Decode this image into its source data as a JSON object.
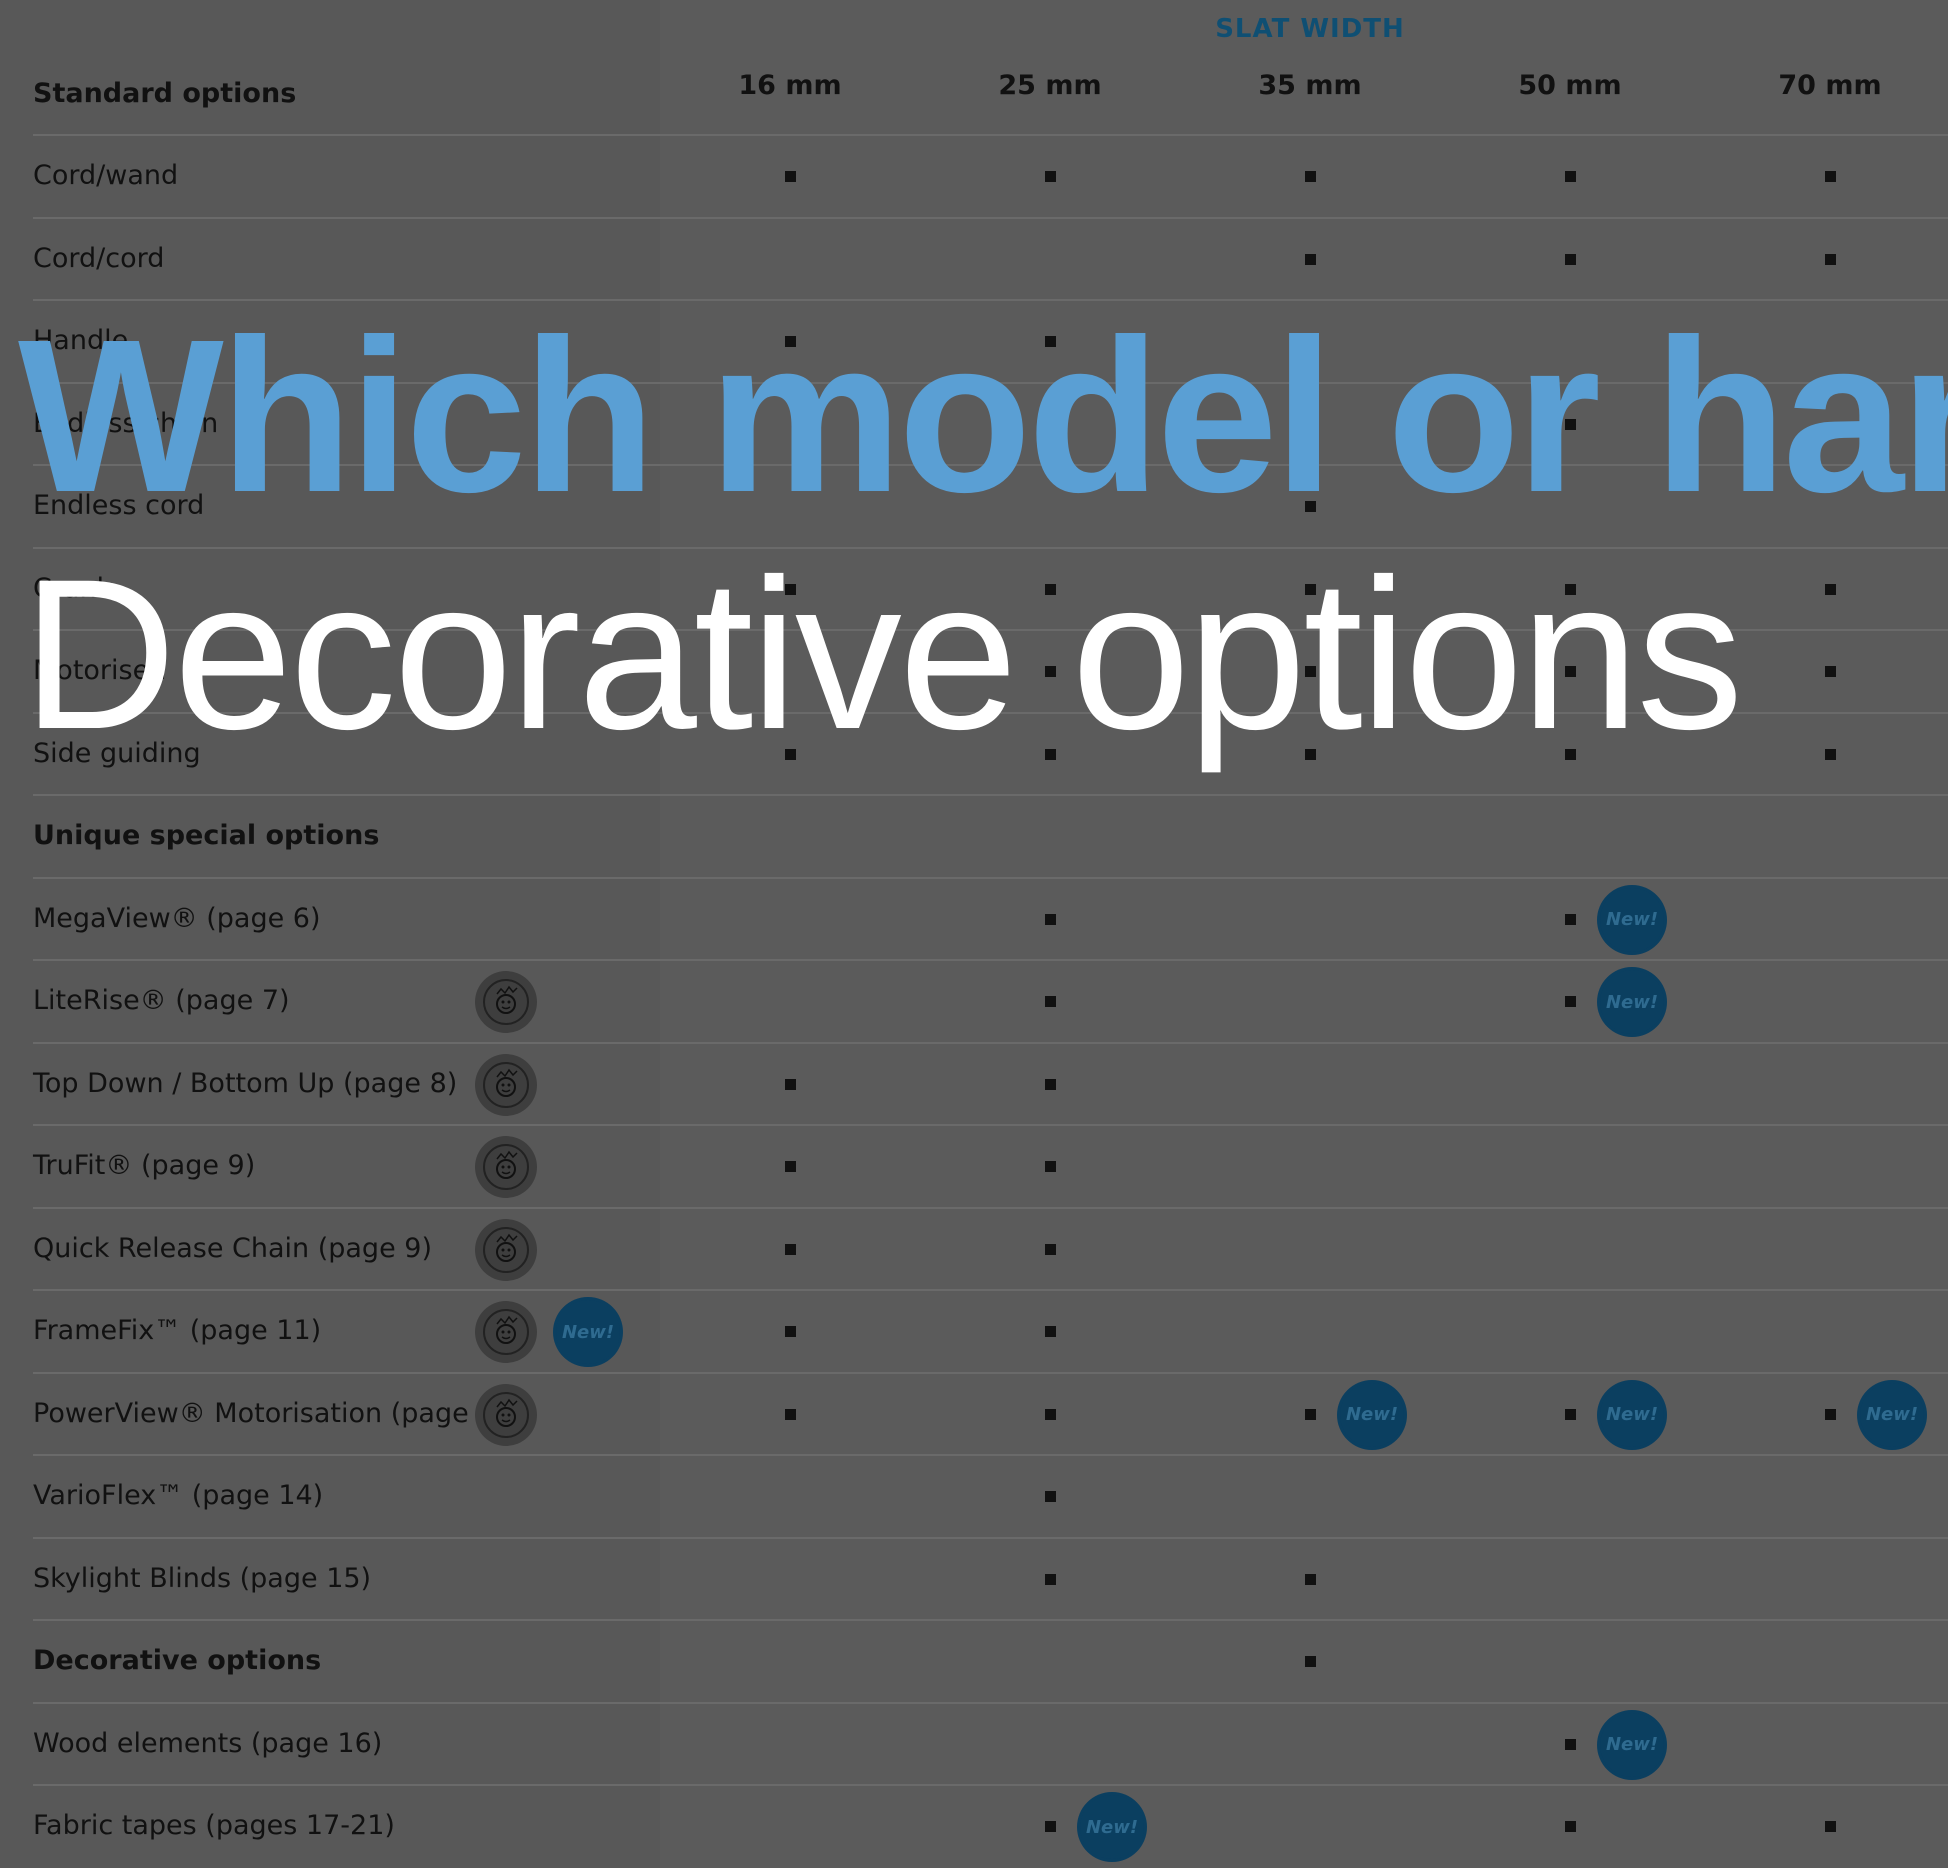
{
  "header": {
    "slat_width_label": "SLAT WIDTH",
    "section_standard": "Standard options",
    "columns": [
      "16 mm",
      "25 mm",
      "35 mm",
      "50 mm",
      "70 mm"
    ]
  },
  "rows": [
    {
      "label": "Cord/wand",
      "marks": [
        1,
        1,
        1,
        1,
        1
      ],
      "bold": false,
      "child_friendly": false,
      "badge_new_label": false,
      "new_after": []
    },
    {
      "label": "Cord/cord",
      "marks": [
        0,
        0,
        1,
        1,
        1
      ],
      "bold": false,
      "child_friendly": false,
      "badge_new_label": false,
      "new_after": []
    },
    {
      "label": "Handle",
      "marks": [
        1,
        1,
        0,
        0,
        0
      ],
      "bold": false,
      "child_friendly": false,
      "badge_new_label": false,
      "new_after": []
    },
    {
      "label": "Endless chain",
      "marks": [
        0,
        1,
        0,
        1,
        0
      ],
      "bold": false,
      "child_friendly": false,
      "badge_new_label": false,
      "new_after": []
    },
    {
      "label": "Endless cord",
      "marks": [
        0,
        0,
        1,
        0,
        0
      ],
      "bold": false,
      "child_friendly": false,
      "badge_new_label": false,
      "new_after": []
    },
    {
      "label": "Crank",
      "marks": [
        1,
        1,
        1,
        1,
        1
      ],
      "bold": false,
      "child_friendly": false,
      "badge_new_label": false,
      "new_after": []
    },
    {
      "label": "Motorised",
      "marks": [
        0,
        1,
        1,
        1,
        1
      ],
      "bold": false,
      "child_friendly": false,
      "badge_new_label": false,
      "new_after": []
    },
    {
      "label": "Side guiding",
      "marks": [
        1,
        1,
        1,
        1,
        1
      ],
      "bold": false,
      "child_friendly": false,
      "badge_new_label": false,
      "new_after": []
    },
    {
      "label": "Unique special options",
      "marks": [
        0,
        0,
        0,
        0,
        0
      ],
      "bold": true,
      "child_friendly": false,
      "badge_new_label": false,
      "new_after": []
    },
    {
      "label": "MegaView® (page 6)",
      "marks": [
        0,
        1,
        0,
        1,
        0
      ],
      "bold": false,
      "child_friendly": false,
      "badge_new_label": false,
      "new_after": [
        3
      ]
    },
    {
      "label": "LiteRise® (page 7)",
      "marks": [
        0,
        1,
        0,
        1,
        0
      ],
      "bold": false,
      "child_friendly": true,
      "badge_new_label": false,
      "new_after": [
        3
      ]
    },
    {
      "label": "Top Down / Bottom Up (page 8)",
      "marks": [
        1,
        1,
        0,
        0,
        0
      ],
      "bold": false,
      "child_friendly": true,
      "badge_new_label": false,
      "new_after": []
    },
    {
      "label": "TruFit® (page 9)",
      "marks": [
        1,
        1,
        0,
        0,
        0
      ],
      "bold": false,
      "child_friendly": true,
      "badge_new_label": false,
      "new_after": []
    },
    {
      "label": "Quick Release Chain (page 9)",
      "marks": [
        1,
        1,
        0,
        0,
        0
      ],
      "bold": false,
      "child_friendly": true,
      "badge_new_label": false,
      "new_after": []
    },
    {
      "label": "FrameFix™ (page 11)",
      "marks": [
        1,
        1,
        0,
        0,
        0
      ],
      "bold": false,
      "child_friendly": true,
      "badge_new_label": true,
      "new_after": []
    },
    {
      "label": "PowerView® Motorisation (page 12)",
      "marks": [
        1,
        1,
        1,
        1,
        1
      ],
      "bold": false,
      "child_friendly": true,
      "badge_new_label": false,
      "new_after": [
        2,
        3,
        4
      ]
    },
    {
      "label": "VarioFlex™ (page 14)",
      "marks": [
        0,
        1,
        0,
        0,
        0
      ],
      "bold": false,
      "child_friendly": false,
      "badge_new_label": false,
      "new_after": []
    },
    {
      "label": "Skylight Blinds (page 15)",
      "marks": [
        0,
        1,
        1,
        0,
        0
      ],
      "bold": false,
      "child_friendly": false,
      "badge_new_label": false,
      "new_after": []
    },
    {
      "label": "Decorative options",
      "marks": [
        0,
        0,
        1,
        0,
        0
      ],
      "bold": true,
      "child_friendly": false,
      "badge_new_label": false,
      "new_after": []
    },
    {
      "label": "Wood elements (page 16)",
      "marks": [
        0,
        0,
        0,
        1,
        0
      ],
      "bold": false,
      "child_friendly": false,
      "badge_new_label": false,
      "new_after": [
        3
      ]
    },
    {
      "label": "Fabric tapes (pages 17-21)",
      "marks": [
        0,
        1,
        0,
        1,
        1
      ],
      "bold": false,
      "child_friendly": false,
      "badge_new_label": false,
      "new_after": [
        1
      ]
    }
  ],
  "badges": {
    "new_text": "New!",
    "child_friendly_icon": "child-friendly-icon"
  },
  "overlay": {
    "title": "Which model or hardw",
    "subtitle": "Decorative options"
  },
  "colors": {
    "title_blue": "#5a9fd4",
    "slat_heading": "#0f4f73",
    "badge_new": "#0b3f60"
  }
}
